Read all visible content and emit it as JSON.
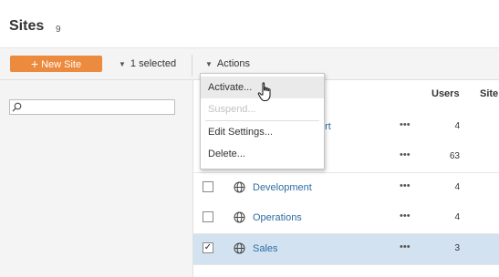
{
  "header": {
    "title": "Sites",
    "count": "9"
  },
  "toolbar": {
    "new_site_label": "New Site",
    "selected_label": "1 selected",
    "actions_label": "Actions"
  },
  "search": {
    "value": "",
    "placeholder": ""
  },
  "table": {
    "columns": {
      "users": "Users",
      "site_truncated": "Site"
    },
    "rows": [
      {
        "name": "Support",
        "visible_fragment": "ort",
        "more": "•••",
        "users": "4",
        "checked": false,
        "selected": false
      },
      {
        "name": "",
        "more": "•••",
        "users": "63",
        "checked": false,
        "selected": false
      },
      {
        "name": "Development",
        "more": "•••",
        "users": "4",
        "checked": false,
        "selected": false
      },
      {
        "name": "Operations",
        "more": "•••",
        "users": "4",
        "checked": false,
        "selected": false
      },
      {
        "name": "Sales",
        "more": "•••",
        "users": "3",
        "checked": true,
        "selected": true
      }
    ]
  },
  "actions_menu": {
    "items": [
      {
        "label": "Activate...",
        "enabled": true,
        "hovered": true
      },
      {
        "label": "Suspend...",
        "enabled": false
      },
      {
        "label": "Edit Settings...",
        "enabled": true
      },
      {
        "label": "Delete...",
        "enabled": true
      }
    ]
  },
  "colors": {
    "accent_orange": "#ec8a3d",
    "link_blue": "#2e6da4",
    "selected_row": "#d3e2f0",
    "toolbar_bg": "#f4f4f4"
  },
  "icons": [
    "plus-icon",
    "caret-down-icon",
    "search-icon",
    "globe-icon",
    "more-icon",
    "checkmark-icon",
    "hand-cursor-icon"
  ]
}
